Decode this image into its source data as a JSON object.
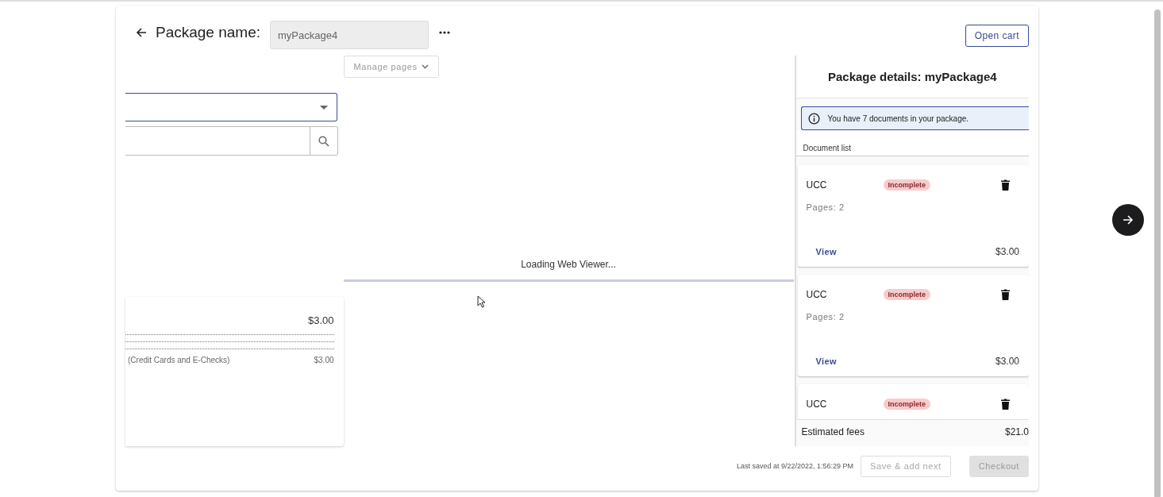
{
  "header": {
    "title": "Package name:",
    "package_name": "myPackage4",
    "open_cart": "Open cart"
  },
  "left_panel": {
    "summary": {
      "rows": [
        {
          "label": "",
          "amount": "$3.00"
        },
        {
          "label": "(Credit Cards and E-Checks)",
          "amount": "$3.00"
        }
      ]
    }
  },
  "viewer": {
    "manage_pages": {
      "label": "Manage pages",
      "disabled": true
    },
    "loading_text": "Loading Web Viewer...",
    "loading_bar": {
      "level": 1
    }
  },
  "package_details": {
    "title": "Package details: myPackage4",
    "info": "You have 7 documents in your package.",
    "list_label": "Document list",
    "documents": [
      {
        "name": "UCC",
        "status": "Incomplete",
        "pages": "Pages: 2",
        "view": "View",
        "price": "$3.00"
      },
      {
        "name": "UCC",
        "status": "Incomplete",
        "pages": "Pages: 2",
        "view": "View",
        "price": "$3.00"
      },
      {
        "name": "UCC",
        "status": "Incomplete"
      }
    ],
    "estimated_fees": {
      "label": "Estimated fees",
      "amount": "$21.0"
    }
  },
  "footer": {
    "last_saved": "Last saved at 9/22/2022, 1:56:29 PM",
    "save_next": {
      "label": "Save & add next",
      "disabled": true
    },
    "checkout": {
      "label": "Checkout",
      "disabled": true
    }
  }
}
